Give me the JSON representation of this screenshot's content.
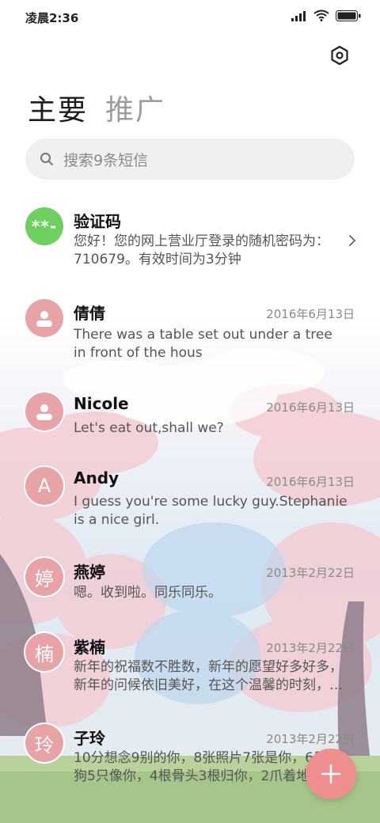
{
  "status": {
    "time": "凌晨2:36"
  },
  "tabs": [
    {
      "label": "主要",
      "active": true
    },
    {
      "label": "推广",
      "active": false
    }
  ],
  "search": {
    "placeholder": "搜索9条短信"
  },
  "conversations": [
    {
      "avatar": "**-",
      "name": "验证码",
      "date": "",
      "preview": "您好！您的网上营业厅登录的随机密码为：710679。有效时间为3分钟"
    },
    {
      "avatar": "person-icon",
      "name": "倩倩",
      "date": "2016年6月13日",
      "preview": "There was a table set out under a tree in front of the hous"
    },
    {
      "avatar": "person-icon",
      "name": "Nicole",
      "date": "2016年6月13日",
      "preview": "Let's eat out,shall we?"
    },
    {
      "avatar": "A",
      "name": "Andy",
      "date": "2016年6月13日",
      "preview": "I guess you're some lucky guy.Stephanie is a nice girl."
    },
    {
      "avatar": "婷",
      "name": "燕婷",
      "date": "2013年2月22日",
      "preview": "嗯。收到啦。同乐同乐。"
    },
    {
      "avatar": "楠",
      "name": "紫楠",
      "date": "2013年2月22日",
      "preview": "新年的祝福数不胜数，新年的愿望好多好多，新年的问候依旧美好，在这个温馨的时刻，…"
    },
    {
      "avatar": "玲",
      "name": "子玲",
      "date": "2013年2月22日",
      "preview": "10分想念9别的你，8张照片7张是你，6只小狗5只像你，4根骨头3根归你，2爪着地"
    }
  ],
  "colors": {
    "accent": "#ef8e8e",
    "avatar_pink": "#e8a3a6",
    "avatar_green": "#6dd05f"
  }
}
